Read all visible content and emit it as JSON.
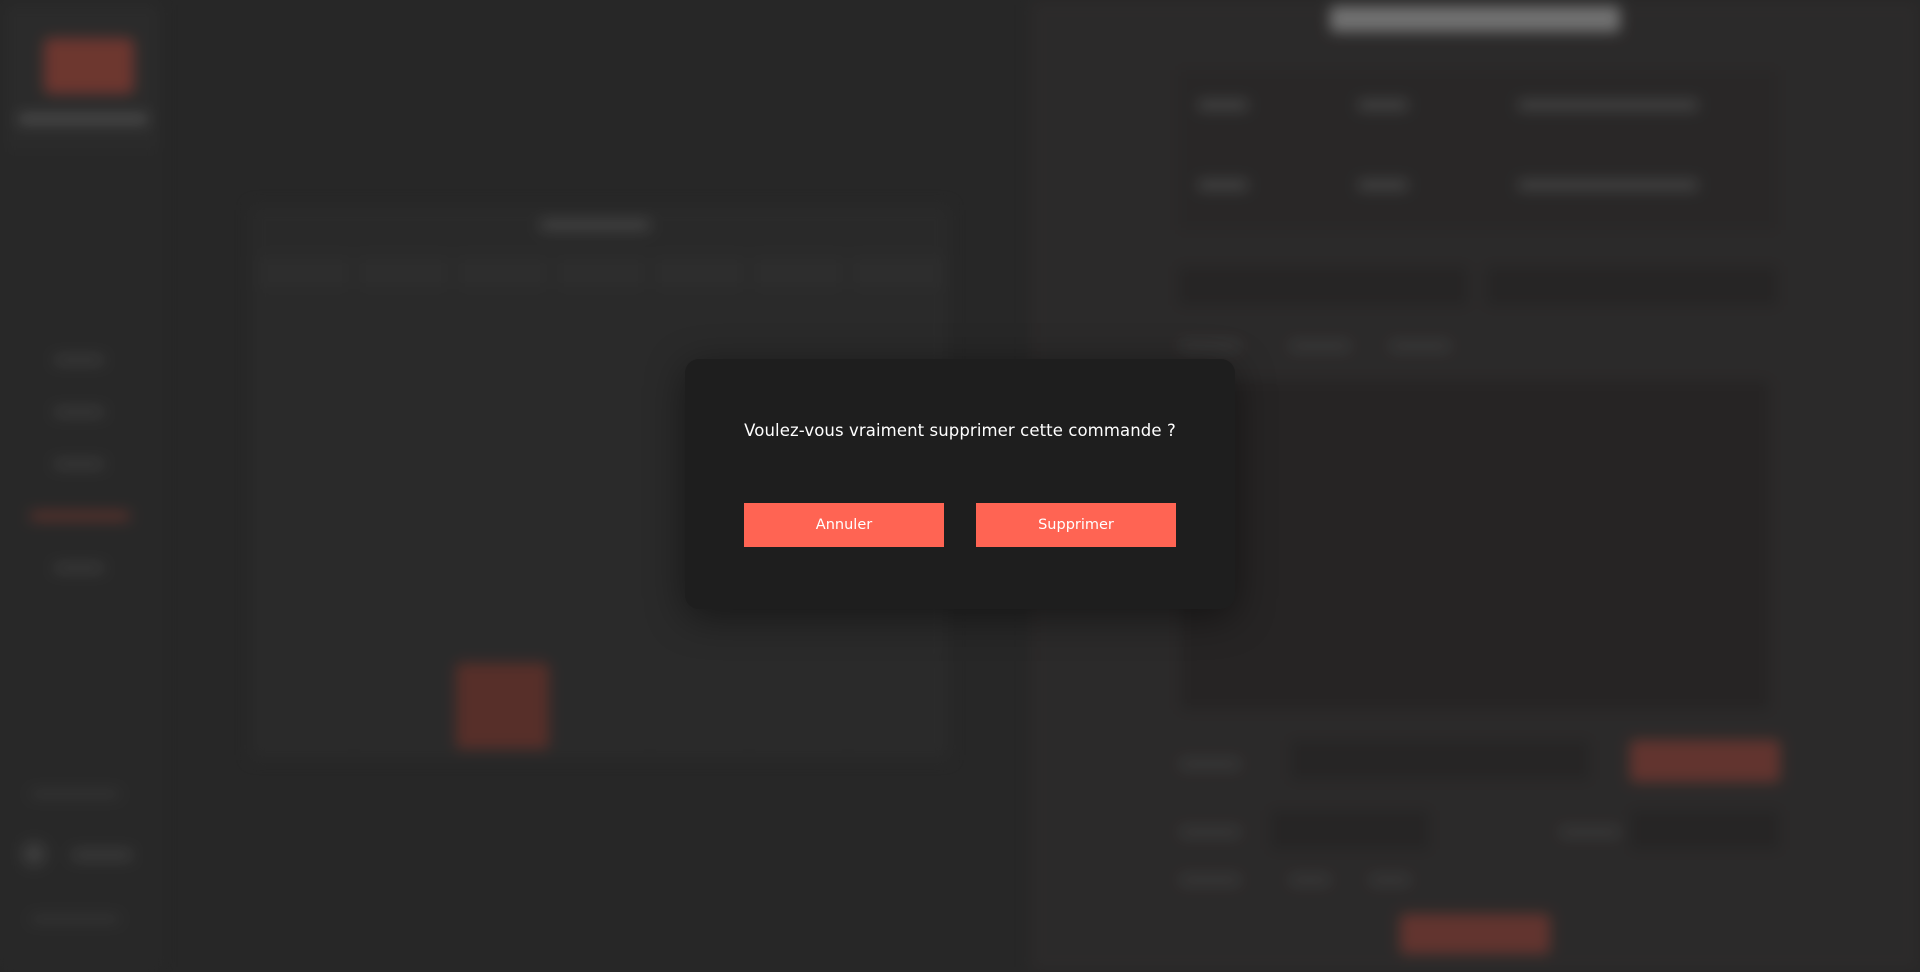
{
  "modal": {
    "question": "Voulez-vous vraiment supprimer cette commande ?",
    "cancel_label": "Annuler",
    "confirm_label": "Supprimer"
  },
  "colors": {
    "background": "#2b2b2b",
    "modal_background": "#1e1e1e",
    "accent": "#ff6453",
    "text": "#ffffff"
  }
}
